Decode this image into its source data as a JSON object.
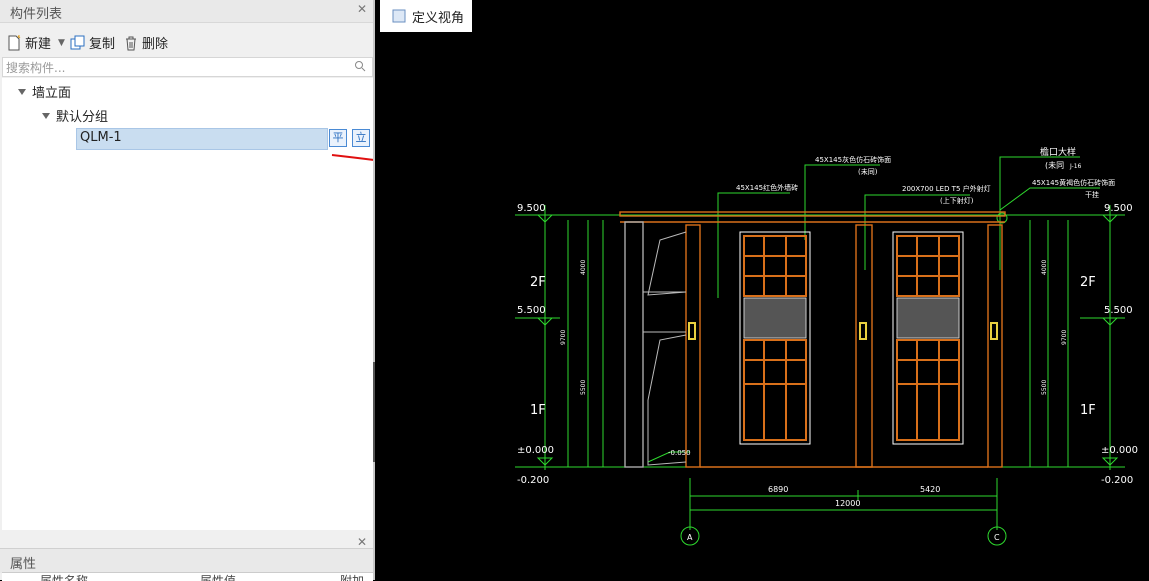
{
  "panels": {
    "component_list": {
      "title": "构件列表"
    },
    "properties": {
      "title": "属性",
      "columns": [
        "属性名称",
        "属性值",
        "附加"
      ]
    }
  },
  "toolbar": {
    "new_label": "新建",
    "copy_label": "复制",
    "delete_label": "删除"
  },
  "search": {
    "placeholder": "搜索构件..."
  },
  "tree": {
    "root": "墙立面",
    "group": "默认分组",
    "selected_item": "QLM-1",
    "plan_btn": "平",
    "elev_btn": "立"
  },
  "view_button": {
    "label": "定义视角"
  },
  "drawing": {
    "levels": {
      "top": "9.500",
      "mid": "5.500",
      "ground": "±0.000",
      "base": "-0.200"
    },
    "floors": {
      "upper": "2F",
      "lower": "1F"
    },
    "dims": {
      "left_span": "6890",
      "right_span": "5420",
      "total": "12000",
      "height_total": "9700",
      "upper": "4000",
      "lower": "5500"
    },
    "axes": {
      "left": "A",
      "right": "C"
    },
    "notes": {
      "n1": "45X145红色外墙砖",
      "n2": "45X145灰色仿石砖饰面",
      "n3": "(未同)",
      "n4": "200X700 LED T5 户外射灯",
      "n5": "(上下射灯)",
      "n6": "檐口大样",
      "n7": "(未同",
      "n8": "45X145黄褐色仿石砖饰面",
      "n9": "干挂",
      "n10": "J-16",
      "ground_tag": "-0.050"
    }
  },
  "colors": {
    "cad_bg": "#000000",
    "green": "#2ed82e",
    "orange": "#d9701a",
    "selection": "#c9ddf0",
    "red_mark": "#e01010"
  }
}
